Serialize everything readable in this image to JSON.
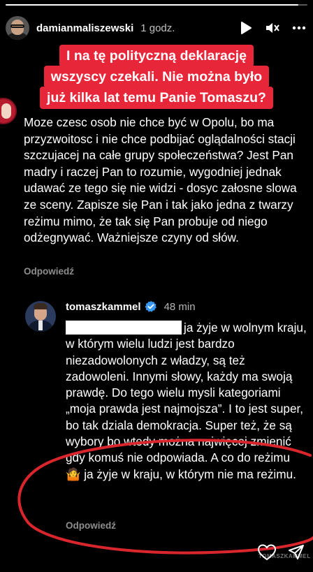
{
  "story": {
    "progress_fraction": 0.97,
    "username": "damianmaliszewski",
    "time": "1 godz."
  },
  "banner": {
    "lines": [
      "I na tę polityczną deklarację",
      "wszyscy czekali. Nie można było",
      "już kilka lat temu Panie Tomaszu?"
    ]
  },
  "comment": {
    "text": "Moze czesc osob nie chce być w Opolu, bo ma przyzwoitosc i nie chce podbijać oglądalności stacji szczujacej na całe grupy społeczeństwa? Jest Pan madry i raczej Pan to rozumie, wygodniej jednak udawać ze tego się nie widzi - dosyc załosne slowa ze sceny. Zapisze się Pan i tak jako jedna z twarzy reżimu mimo, że tak się Pan probuje od niego odżegnywać. Ważniejsze czyny od słów.",
    "reply_label": "Odpowiedź"
  },
  "reply": {
    "username": "tomaszkammel",
    "time": "48 min",
    "text": "ja żyje w wolnym kraju, w którym wielu ludzi jest bardzo niezadowolonych z władzy, są też zadowoleni. Innymi słowy, każdy ma swoją prawdę. Do tego wielu mysli kategoriami „moja prawda jest najmojsza”. I to jest super, bo tak dziala demokracja. Super też, że są wybory bo wtedy można najwięcej zmienić gdy komuś nie odpowiada. A co do reżimu",
    "text_end": "ja żyje w kraju, w którym nie ma reżimu.",
    "emoji": "🤷",
    "reply_label": "Odpowiedź"
  },
  "watermark": "TOMASZKAMMEL",
  "colors": {
    "banner_red": "#e8263a",
    "annotation_red": "#d9262c",
    "verified_blue": "#3897f0"
  },
  "icons": {
    "play": "play-icon",
    "mute": "mute-icon",
    "more": "more-icon",
    "like": "heart-icon",
    "share": "send-icon"
  }
}
